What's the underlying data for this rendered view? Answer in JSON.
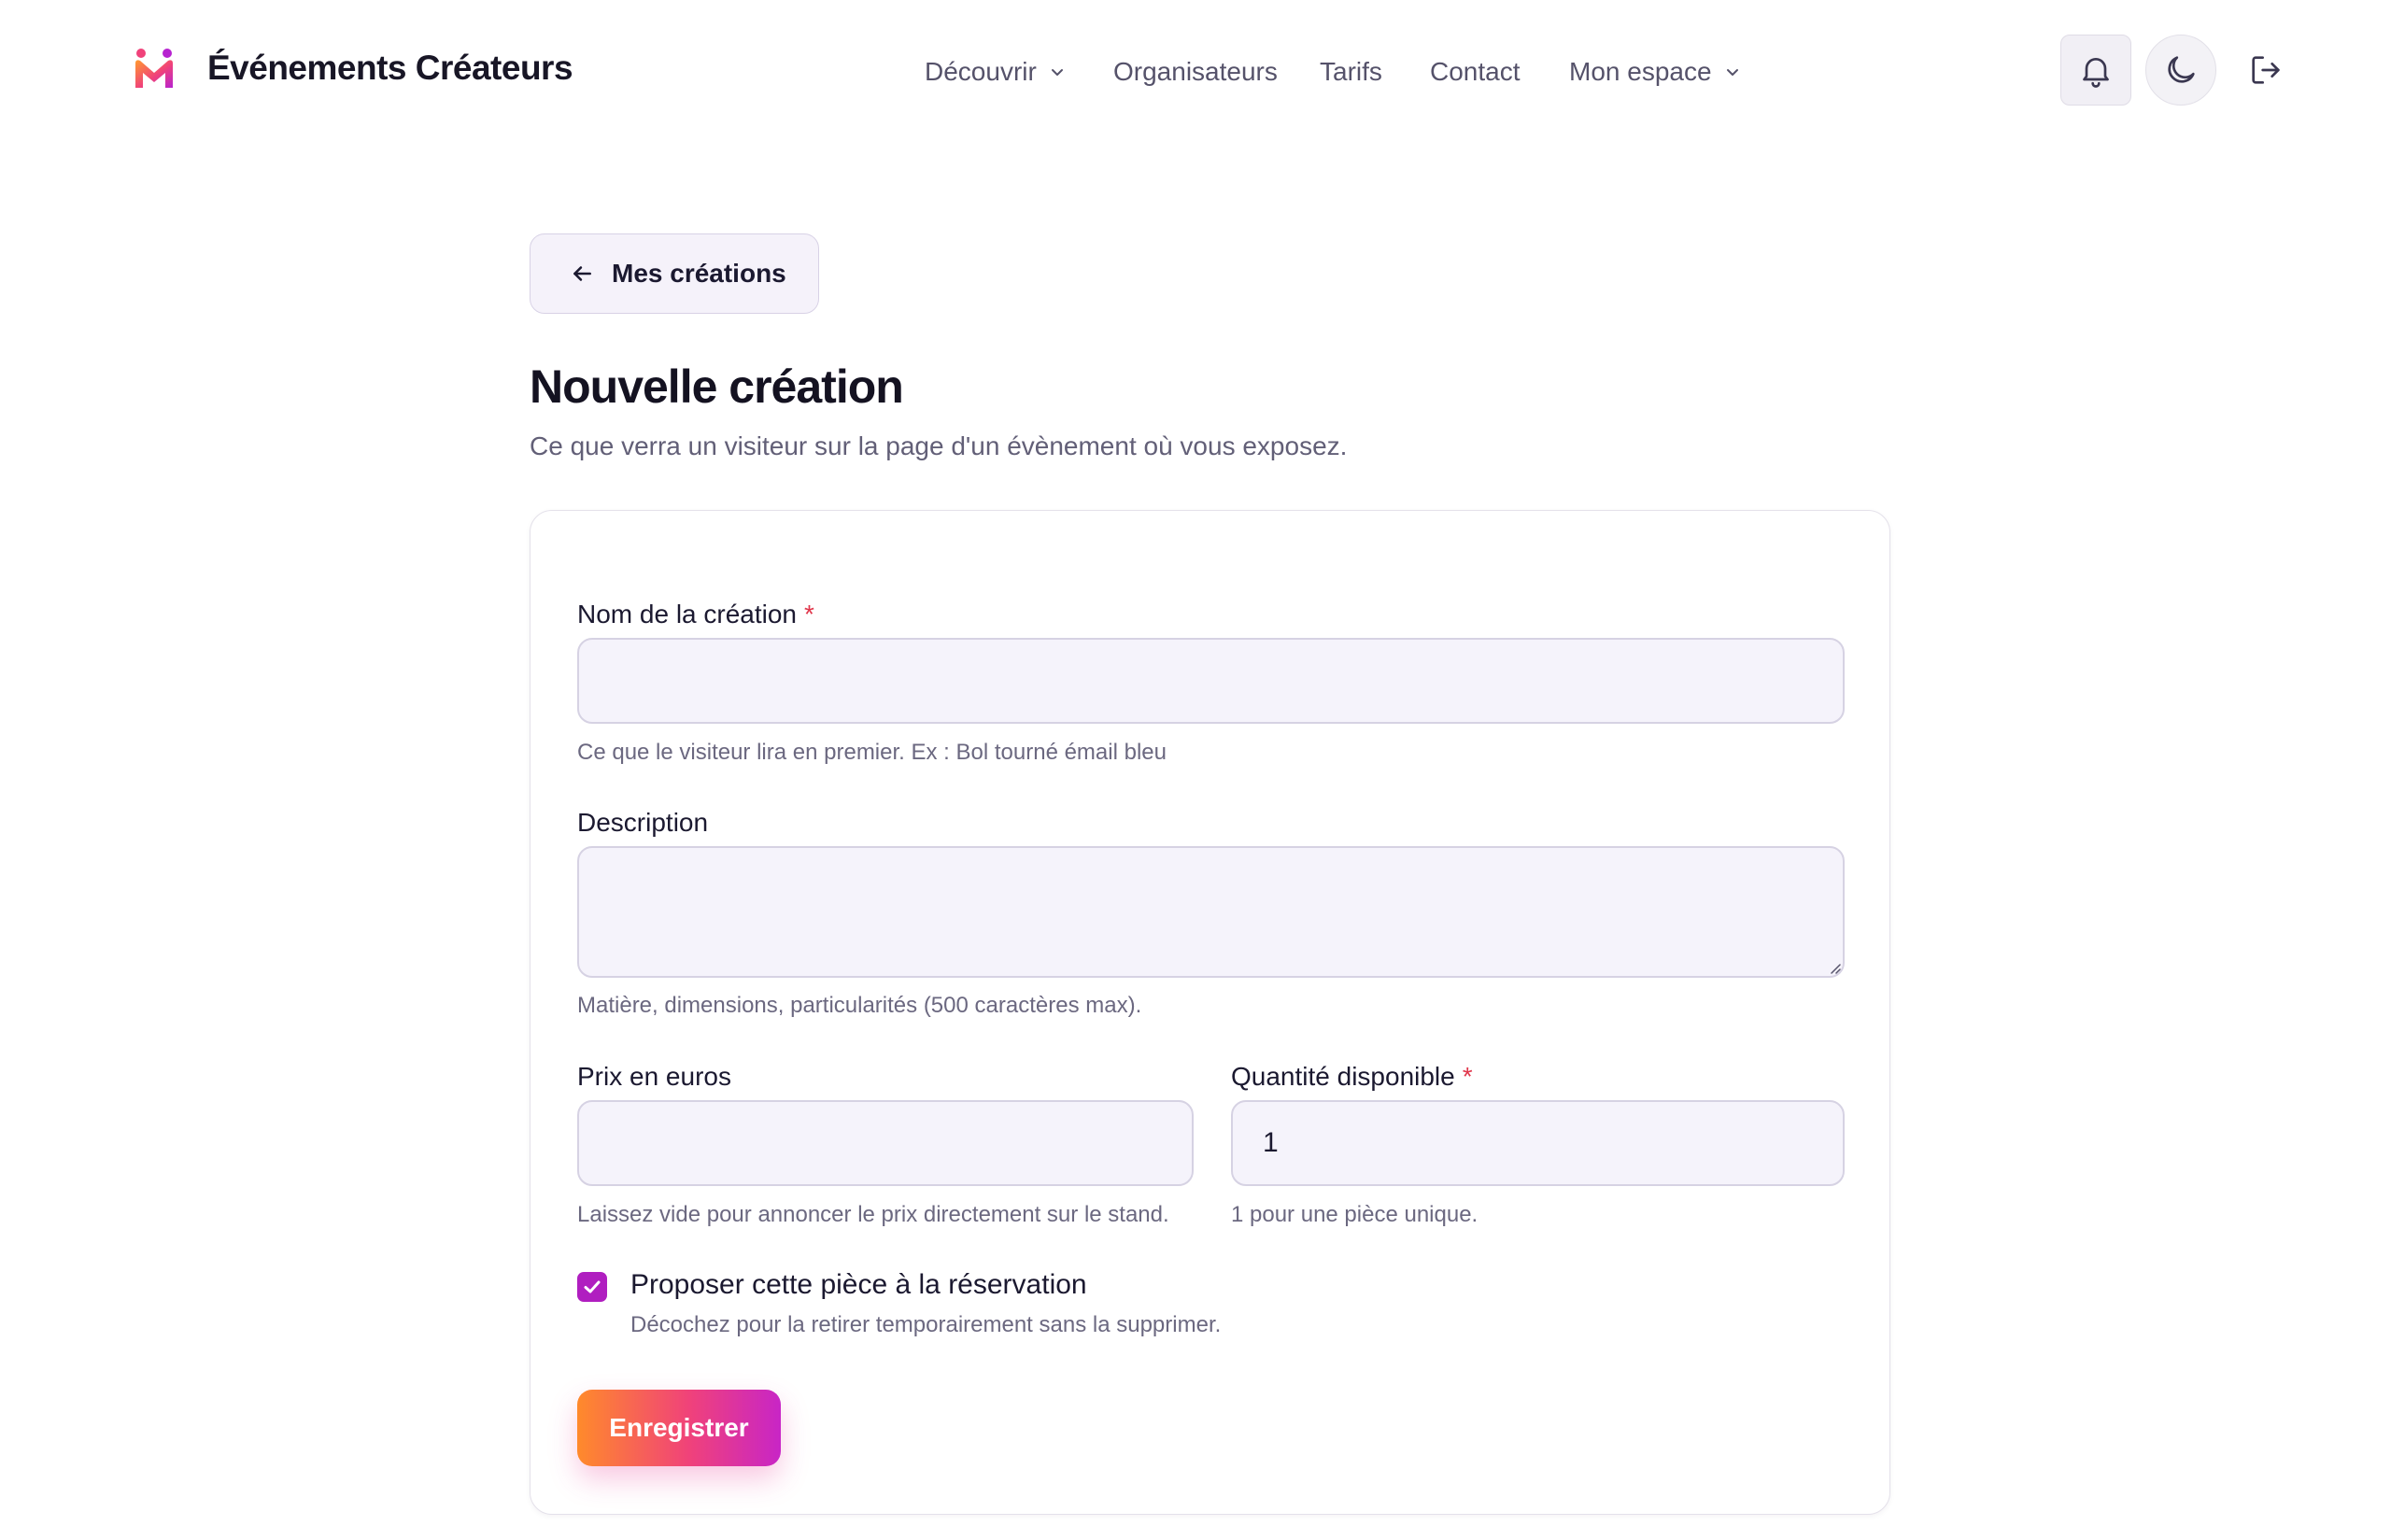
{
  "brand": {
    "name": "Événements Créateurs"
  },
  "nav": {
    "items": [
      {
        "label": "Découvrir",
        "has_dropdown": true
      },
      {
        "label": "Organisateurs",
        "has_dropdown": false
      },
      {
        "label": "Tarifs",
        "has_dropdown": false
      },
      {
        "label": "Contact",
        "has_dropdown": false
      },
      {
        "label": "Mon espace",
        "has_dropdown": true
      }
    ]
  },
  "header_icons": [
    "bell-icon",
    "moon-icon",
    "logout-icon"
  ],
  "back_button": {
    "label": "Mes créations",
    "icon": "arrow-left-icon"
  },
  "page": {
    "title": "Nouvelle création",
    "subtitle": "Ce que verra un visiteur sur la page d'un évènement où vous exposez."
  },
  "form": {
    "name": {
      "label": "Nom de la création",
      "required": "*",
      "value": "",
      "help": "Ce que le visiteur lira en premier. Ex : Bol tourné émail bleu"
    },
    "description": {
      "label": "Description",
      "value": "",
      "help": "Matière, dimensions, particularités (500 caractères max)."
    },
    "price": {
      "label": "Prix en euros",
      "value": "",
      "help": "Laissez vide pour annoncer le prix directement sur le stand."
    },
    "quantity": {
      "label": "Quantité disponible",
      "required": "*",
      "value": "1",
      "help": "1 pour une pièce unique."
    },
    "reservable": {
      "label": "Proposer cette pièce à la réservation",
      "checked": true,
      "help": "Décochez pour la retirer temporairement sans la supprimer."
    },
    "submit_label": "Enregistrer"
  },
  "colors": {
    "accent_purple": "#b01ec0",
    "gradient_start": "#ff8a2b",
    "gradient_mid": "#f0427a",
    "gradient_end": "#c825c6",
    "required": "#e0364b",
    "input_bg": "#f5f3fb"
  }
}
